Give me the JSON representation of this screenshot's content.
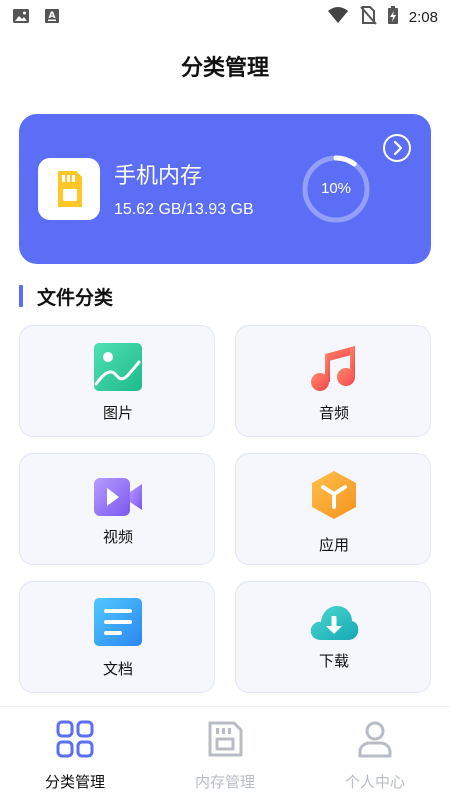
{
  "status_bar": {
    "time": "2:08",
    "icons": [
      "gallery-icon",
      "keyboard-icon",
      "wifi-icon",
      "no-sim-icon",
      "battery-charging-icon"
    ]
  },
  "page": {
    "title": "分类管理"
  },
  "storage": {
    "title": "手机内存",
    "size": "15.62 GB/13.93 GB",
    "percent_label": "10%",
    "percent_value": 0.1,
    "icon": "sd-card-icon",
    "arrow_icon": "chevron-right-circle-icon"
  },
  "section": {
    "title": "文件分类"
  },
  "categories": [
    {
      "label": "图片",
      "icon": "image-icon"
    },
    {
      "label": "音频",
      "icon": "music-icon"
    },
    {
      "label": "视频",
      "icon": "video-icon"
    },
    {
      "label": "应用",
      "icon": "app-cube-icon"
    },
    {
      "label": "文档",
      "icon": "document-icon"
    },
    {
      "label": "下载",
      "icon": "cloud-download-icon"
    }
  ],
  "bottom_nav": {
    "items": [
      {
        "label": "分类管理",
        "icon": "grid-icon",
        "active": true
      },
      {
        "label": "内存管理",
        "icon": "sd-card-outline-icon",
        "active": false
      },
      {
        "label": "个人中心",
        "icon": "user-icon",
        "active": false
      }
    ]
  },
  "colors": {
    "accent": "#5b6ef5",
    "nav_active": "#5b6ef5",
    "nav_inactive": "#b8bcc6"
  }
}
